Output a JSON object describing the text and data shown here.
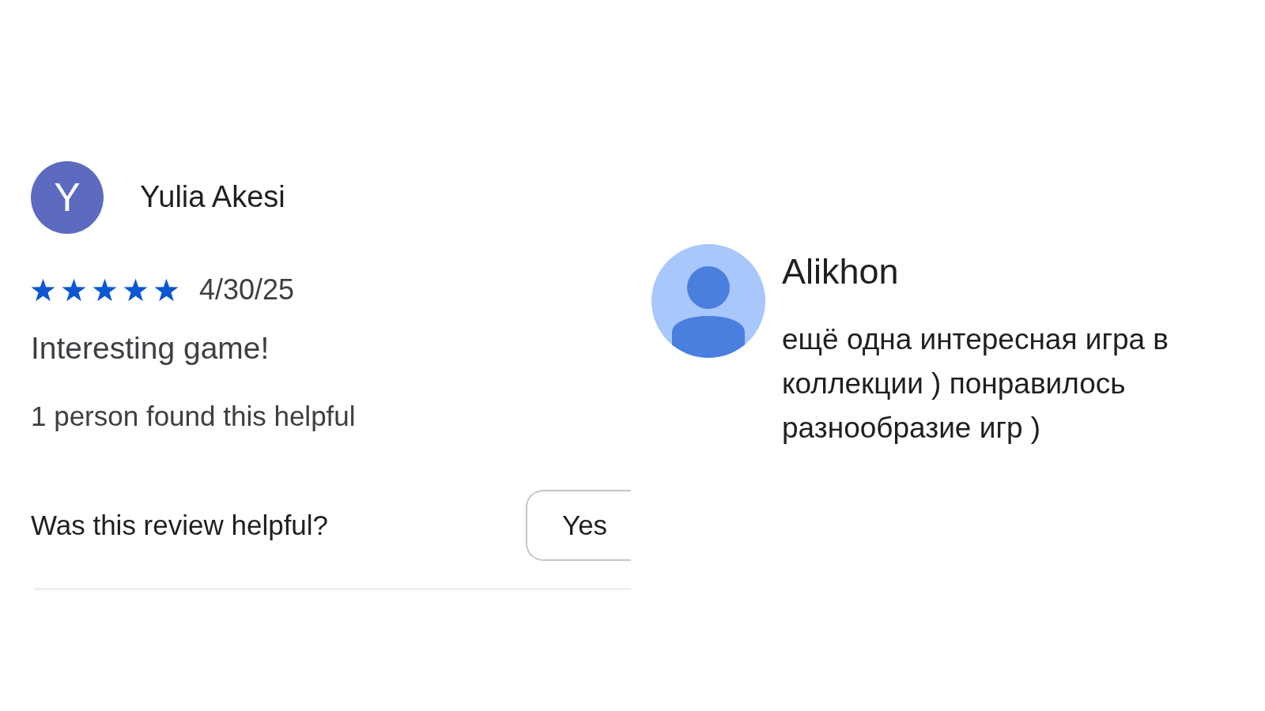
{
  "review": {
    "avatar_letter": "Y",
    "author": "Yulia Akesi",
    "stars": 5,
    "date": "4/30/25",
    "text": "Interesting game!",
    "helpful_count": "1 person found this helpful",
    "helpful_prompt": "Was this review helpful?",
    "buttons": [
      "Yes"
    ]
  },
  "comment": {
    "author": "Alikhon",
    "text": "ещё одна интересная игра в коллекции ) понравилось разнообразие игр )"
  }
}
